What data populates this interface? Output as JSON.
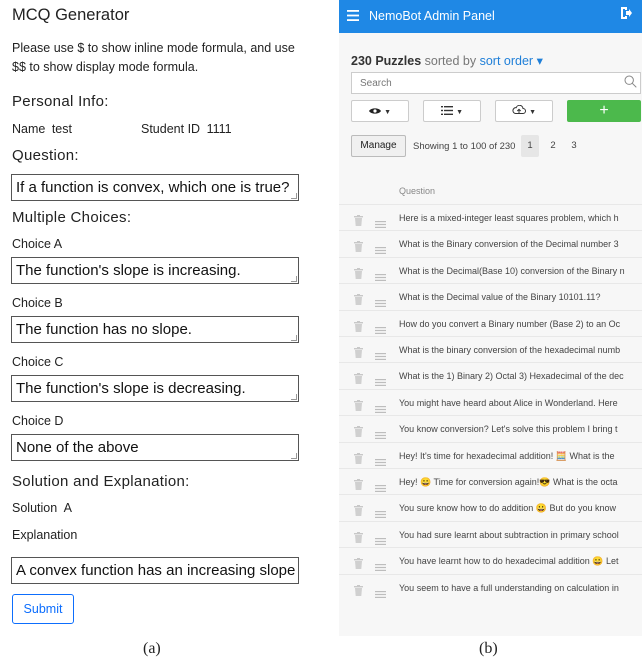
{
  "panel_a": {
    "title": "MCQ Generator",
    "instructions": "Please use $ to show inline mode formula, and use $$ to show display mode formula.",
    "personal_info_heading": "Personal Info:",
    "name_label": "Name",
    "name_value": "test",
    "student_id_label": "Student ID",
    "student_id_value": "1111",
    "question_heading": "Question:",
    "question_value": "If a function is convex, which one is true?",
    "choices_heading": "Multiple Choices:",
    "choices": [
      {
        "label": "Choice A",
        "value": "The function's slope is increasing."
      },
      {
        "label": "Choice B",
        "value": "The function has no slope."
      },
      {
        "label": "Choice C",
        "value": "The function's slope is decreasing."
      },
      {
        "label": "Choice D",
        "value": "None of the above"
      }
    ],
    "solution_heading": "Solution and Explanation:",
    "solution_label": "Solution",
    "solution_value": "A",
    "explanation_label": "Explanation",
    "explanation_value": "A convex function has an increasing slope",
    "submit_label": "Submit",
    "accent_color": "#0d6efd"
  },
  "panel_b": {
    "app_title": "NemoBot Admin Panel",
    "topbar_color": "#1f88e5",
    "count_text": "230 Puzzles",
    "sorted_by_text": "sorted by",
    "sort_link": "sort order",
    "search_placeholder": "Search",
    "tool_icons": [
      "eye-icon",
      "list-icon",
      "cloud-upload-icon"
    ],
    "add_label": "+",
    "add_color": "#4cb94c",
    "manage_label": "Manage",
    "showing_text": "Showing 1 to 100 of 230",
    "pages": [
      "1",
      "2",
      "3"
    ],
    "active_page": "1",
    "column_header": "Question",
    "rows": [
      "Here is a mixed-integer least squares problem, which h",
      "What is the Binary conversion of the Decimal number 3",
      "What is the Decimal(Base 10) conversion of the Binary n",
      "What is the Decimal value of the Binary 10101.11?",
      "How do you convert a Binary number (Base 2) to an Oc",
      "What is the binary conversion of the hexadecimal numb",
      "What is the 1) Binary 2) Octal 3) Hexadecimal of the dec",
      "You might have heard about Alice in Wonderland. Here",
      "You know conversion? Let's solve this problem I bring t",
      "Hey! It's time for hexadecimal addition! 🧮 What is the",
      "Hey! 😀 Time for conversion again!😎 What is the octa",
      "You sure know how to do addition 😀 But do you know",
      "You had sure learnt about subtraction in primary school",
      "You have learnt how to do hexadecimal addition 😀 Let",
      "You seem to have a full understanding on calculation in"
    ]
  },
  "captions": {
    "a": "(a)",
    "b": "(b)"
  }
}
